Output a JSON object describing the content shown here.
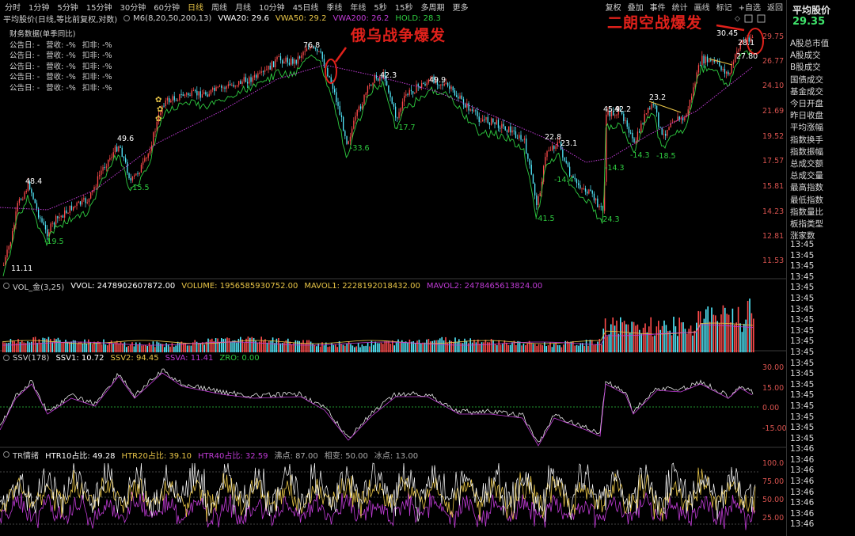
{
  "toolbar": {
    "timeframes": [
      "分时",
      "1分钟",
      "5分钟",
      "15分钟",
      "30分钟",
      "60分钟",
      "日线",
      "周线",
      "月线",
      "10分钟",
      "45日线",
      "季线",
      "年线",
      "5秒",
      "15秒",
      "多周期",
      "更多"
    ],
    "active_timeframe": "日线",
    "right_buttons": [
      "复权",
      "叠加",
      "事件",
      "统计",
      "画线",
      "标记",
      "+自选",
      "返回"
    ]
  },
  "main_chart": {
    "title": "平均股价(日线,等比前复权,对数)",
    "ma_label": "M6(8,20,50,200,13)",
    "vwa20": "VWA20: 29.6",
    "vwa50": "VWA50: 29.2",
    "vwa200": "VWA200: 26.2",
    "hold": "HOLD: 28.3",
    "y_ticks": [
      "29.75",
      "26.77",
      "24.10",
      "21.69",
      "19.52",
      "17.57",
      "15.81",
      "14.23",
      "12.81",
      "11.53"
    ],
    "price_labels": [
      "11.11",
      "-19.5",
      "48.4",
      "49.6",
      "-15.5",
      "76.8",
      "-33.6",
      "42.3",
      "-17.7",
      "49.9",
      "22.8",
      "-14.4",
      "-41.5",
      "-24.3",
      "45.9",
      "42.2",
      "-14.3",
      "23.2",
      "-14.3",
      "-18.5",
      "30.45",
      "28.1",
      "27.80",
      "23.1"
    ]
  },
  "financial_data": {
    "title": "财务数据(单季同比)",
    "rows": [
      [
        "公告日: -",
        "营收: -%",
        "扣非: -%"
      ],
      [
        "公告日: -",
        "营收: -%",
        "扣非: -%"
      ],
      [
        "公告日: -",
        "营收: -%",
        "扣非: -%"
      ],
      [
        "公告日: -",
        "营收: -%",
        "扣非: -%"
      ],
      [
        "公告日: -",
        "营收: -%",
        "扣非: -%"
      ]
    ]
  },
  "annotations": {
    "left": "俄乌战争爆发",
    "right": "二朗空战爆发"
  },
  "volume_panel": {
    "name": "VOL_金(3,25)",
    "vvol": "VVOL: 2478902607872.00",
    "volume": "VOLUME: 1956585930752.00",
    "mavol1": "MAVOL1: 2228192018432.00",
    "mavol2": "MAVOL2: 2478465613824.00"
  },
  "ssv_panel": {
    "name": "SSV(178)",
    "ssv1": "SSV1: 10.72",
    "ssv2": "SSV2: 94.45",
    "ssva": "SSVA: 11.41",
    "zro": "ZRO: 0.00",
    "y_ticks": [
      "30.00",
      "15.00",
      "0.00",
      "-15.00"
    ]
  },
  "tr_panel": {
    "name": "TR情绪",
    "htr10": "HTR10占比: 49.28",
    "htr20": "HTR20占比: 39.10",
    "htr40": "HTR40占比: 32.59",
    "hot": "沸点: 87.00",
    "flat": "相变: 50.00",
    "cold": "冰点: 13.00",
    "y_ticks": [
      "100.0",
      "75.00",
      "50.00",
      "25.00"
    ]
  },
  "sidebar": {
    "title": "平均股价",
    "price": "29.35",
    "items": [
      "A股总市值",
      "A股成交",
      "B股成交",
      "国债成交",
      "基金成交",
      "今日开盘",
      "昨日收盘",
      "平均涨幅",
      "指数换手",
      "指数振幅",
      "总成交额",
      "总成交量",
      "最高指数",
      "最低指数",
      "指数量比",
      "板指类型",
      "涨家数"
    ],
    "times": [
      "13:45",
      "13:45",
      "13:45",
      "13:45",
      "13:45",
      "13:45",
      "13:45",
      "13:45",
      "13:45",
      "13:45",
      "13:45",
      "13:45",
      "13:45",
      "13:45",
      "13:45",
      "13:45",
      "13:45",
      "13:45",
      "13:45",
      "13:46",
      "13:46",
      "13:46",
      "13:46",
      "13:46",
      "13:46",
      "13:46",
      "13:46"
    ]
  },
  "colors": {
    "up": "#ff4b4b",
    "down": "#53ecff",
    "green_line": "#2ecc40",
    "purple_line": "#c03bd6",
    "yellow": "#e8c547",
    "annotation": "#e0211b",
    "price_green": "#3fe46b"
  }
}
